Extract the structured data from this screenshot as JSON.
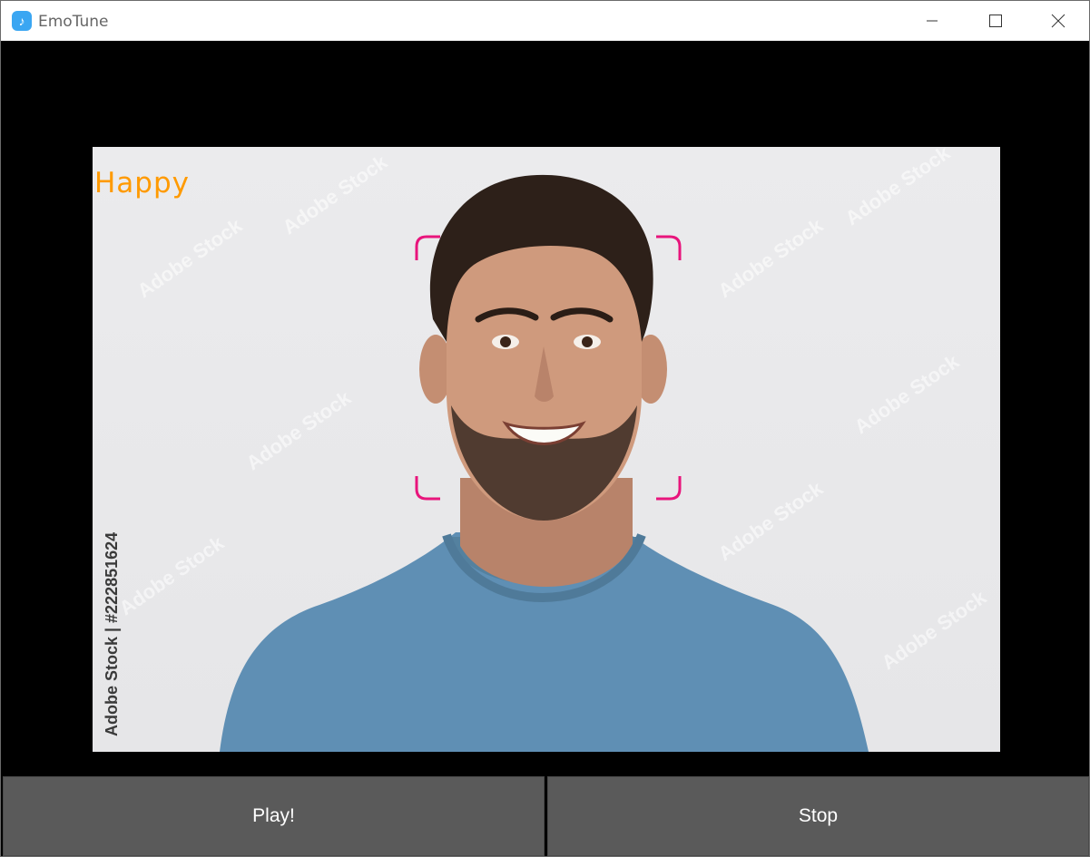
{
  "window": {
    "title": "EmoTune",
    "app_icon_glyph": "♪",
    "app_icon_color": "#3aa6f2",
    "icons": [
      "music-note-icon",
      "minimize-icon",
      "maximize-icon",
      "close-icon"
    ]
  },
  "video": {
    "emotion_label": "Happy",
    "emotion_color": "#ff9a00",
    "face_box_color": "#e8157c",
    "stock_caption": "Adobe Stock | #222851624"
  },
  "controls": {
    "play_label": "Play!",
    "stop_label": "Stop"
  }
}
